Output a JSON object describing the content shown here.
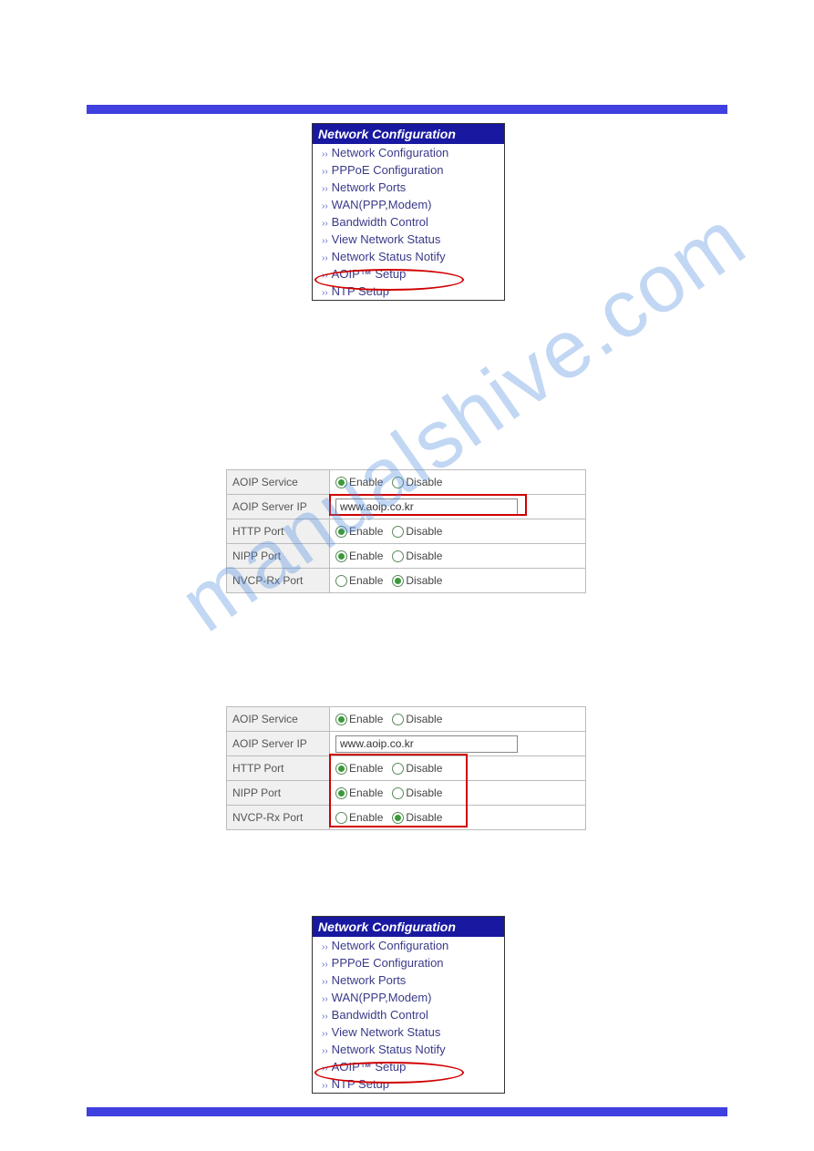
{
  "watermark": "manualshive.com",
  "nav": {
    "header": "Network Configuration",
    "items": [
      "Network Configuration",
      "PPPoE Configuration",
      "Network Ports",
      "WAN(PPP,Modem)",
      "Bandwidth Control",
      "View Network Status",
      "Network Status Notify",
      "AOIP™ Setup",
      "NTP Setup"
    ],
    "highlighted_index": 7
  },
  "table1": {
    "rows": [
      {
        "label": "AOIP Service",
        "type": "radio",
        "enable": true
      },
      {
        "label": "AOIP Server IP",
        "type": "text",
        "value": "www.aoip.co.kr",
        "highlight": true
      },
      {
        "label": "HTTP Port",
        "type": "radio",
        "enable": true
      },
      {
        "label": "NIPP Port",
        "type": "radio",
        "enable": true
      },
      {
        "label": "NVCP-Rx Port",
        "type": "radio",
        "enable": false
      }
    ],
    "radio_labels": {
      "enable": "Enable",
      "disable": "Disable"
    }
  },
  "table2": {
    "rows": [
      {
        "label": "AOIP Service",
        "type": "radio",
        "enable": true
      },
      {
        "label": "AOIP Server IP",
        "type": "text",
        "value": "www.aoip.co.kr"
      },
      {
        "label": "HTTP Port",
        "type": "radio",
        "enable": true,
        "group_highlight": true
      },
      {
        "label": "NIPP Port",
        "type": "radio",
        "enable": true,
        "group_highlight": true
      },
      {
        "label": "NVCP-Rx Port",
        "type": "radio",
        "enable": false,
        "group_highlight": true
      }
    ],
    "radio_labels": {
      "enable": "Enable",
      "disable": "Disable"
    }
  }
}
